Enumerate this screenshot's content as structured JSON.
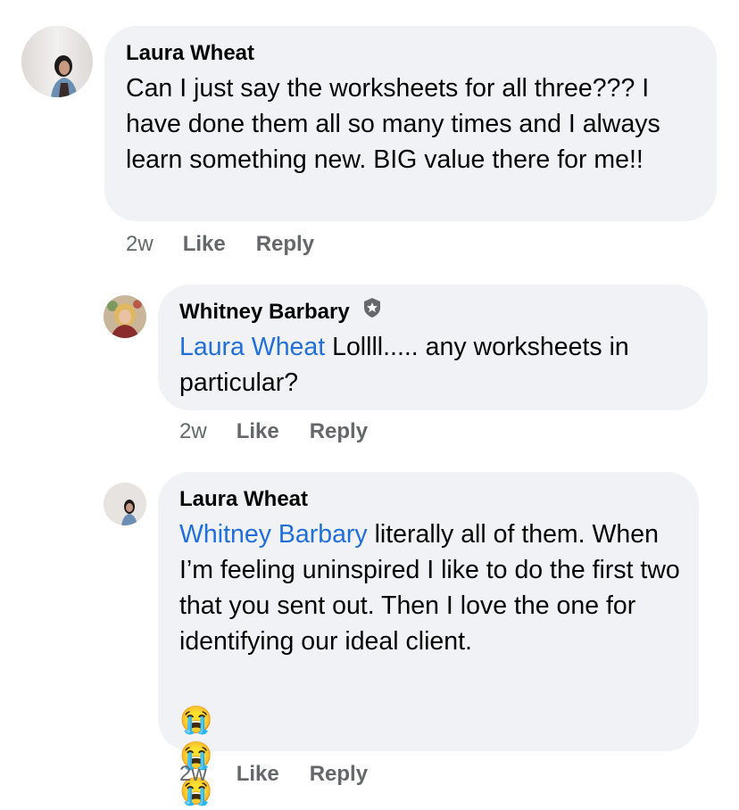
{
  "comments": [
    {
      "author": "Laura Wheat",
      "text": "Can I just say the worksheets for all three??? I have done them all so many times and I always learn something new. BIG value there for me!!",
      "time": "2w",
      "like_label": "Like",
      "reply_label": "Reply"
    },
    {
      "author": "Whitney Barbary",
      "badge_icon": "shield-badge-icon",
      "mention": "Laura Wheat",
      "text": " Lollll..... any worksheets in particular?",
      "time": "2w",
      "like_label": "Like",
      "reply_label": "Reply"
    },
    {
      "author": "Laura Wheat",
      "mention": "Whitney Barbary",
      "text": " literally all of them. When I’m feeling uninspired I like to do the first two that you sent out. Then I love the one for identifying our ideal client.",
      "emojis": "😭😭😭",
      "time": "2w",
      "like_label": "Like",
      "reply_label": "Reply"
    }
  ],
  "colors": {
    "bubble": "#f0f2f5",
    "mention": "#216fdb",
    "meta": "#65676b"
  }
}
